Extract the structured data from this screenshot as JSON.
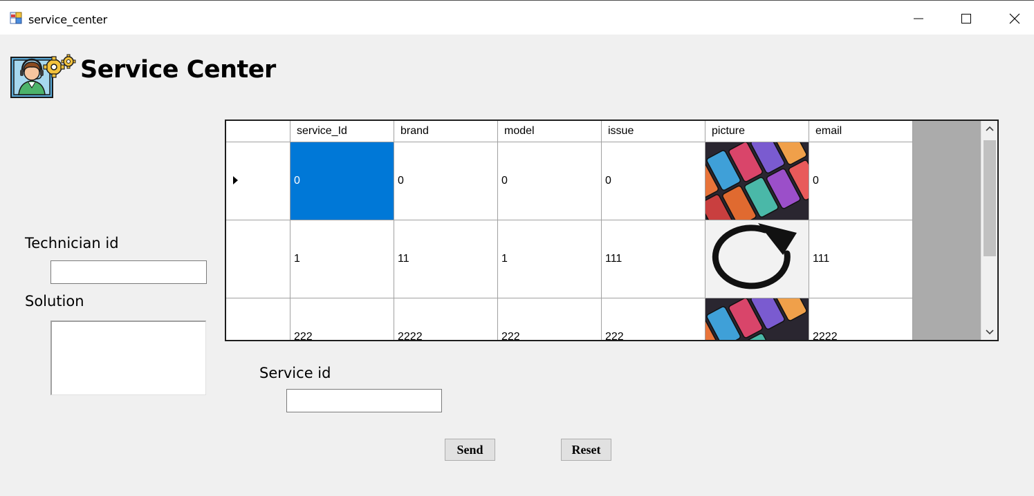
{
  "window": {
    "title": "service_center"
  },
  "header": {
    "title": "Service Center",
    "logo_icon": "technician-support-icon"
  },
  "form": {
    "technician_label": "Technician id",
    "technician_value": "",
    "solution_label": "Solution",
    "solution_value": "",
    "service_label": "Service id",
    "service_value": ""
  },
  "buttons": {
    "send": "Send",
    "reset": "Reset"
  },
  "grid": {
    "columns": [
      "service_Id",
      "brand",
      "model",
      "issue",
      "picture",
      "email"
    ],
    "rows": [
      {
        "service_id": "0",
        "brand": "0",
        "model": "0",
        "issue": "0",
        "picture": "phones-photo",
        "email": "0"
      },
      {
        "service_id": "1",
        "brand": "11",
        "model": "1",
        "issue": "111",
        "picture": "reload-icon-image",
        "email": "111"
      },
      {
        "service_id": "222",
        "brand": "2222",
        "model": "222",
        "issue": "222",
        "picture": "phones-photo",
        "email": "2222"
      }
    ],
    "selected_color": "#0078d7"
  }
}
